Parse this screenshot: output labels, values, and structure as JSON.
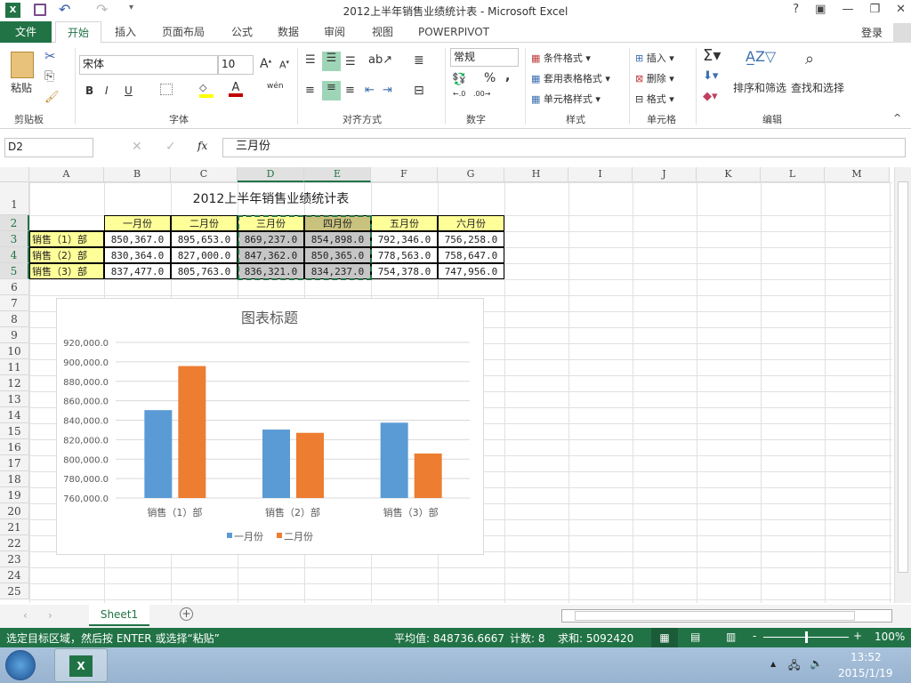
{
  "window": {
    "title": "2012上半年销售业绩统计表 - Microsoft Excel",
    "controls": [
      "?",
      "▣",
      "—",
      "❐",
      "✕"
    ]
  },
  "ribbon_tabs": [
    {
      "label": "文件",
      "active": false,
      "file": true
    },
    {
      "label": "开始",
      "active": true
    },
    {
      "label": "插入"
    },
    {
      "label": "页面布局"
    },
    {
      "label": "公式"
    },
    {
      "label": "数据"
    },
    {
      "label": "审阅"
    },
    {
      "label": "视图"
    },
    {
      "label": "POWERPIVOT"
    }
  ],
  "login": "登录",
  "ribbon": {
    "clipboard": {
      "paste": "粘贴",
      "label": "剪贴板"
    },
    "font": {
      "name": "宋体",
      "size": "10",
      "label": "字体",
      "bold": "B",
      "italic": "I",
      "underline": "U",
      "phonetic": "wén"
    },
    "alignment": {
      "label": "对齐方式"
    },
    "number": {
      "format": "常规",
      "label": "数字",
      "percent": "%",
      "comma": ","
    },
    "styles": {
      "conditional": "条件格式",
      "table": "套用表格格式",
      "cell": "单元格样式",
      "label": "样式"
    },
    "cells": {
      "insert": "插入",
      "delete": "删除",
      "format": "格式",
      "label": "单元格"
    },
    "editing": {
      "sort": "排序和筛选",
      "find": "查找和选择",
      "label": "编辑"
    }
  },
  "formula_bar": {
    "name_box": "D2",
    "formula": "三月份",
    "fx": "fx"
  },
  "columns": [
    "A",
    "B",
    "C",
    "D",
    "E",
    "F",
    "G",
    "H",
    "I",
    "J",
    "K",
    "L",
    "M"
  ],
  "selected_columns": [
    "D",
    "E"
  ],
  "rows": [
    "1",
    "2",
    "3",
    "4",
    "5",
    "6",
    "7",
    "8",
    "9",
    "10",
    "11",
    "12",
    "13",
    "14",
    "15",
    "16",
    "17",
    "18",
    "19",
    "20",
    "21",
    "22",
    "23",
    "24",
    "25"
  ],
  "sheet": {
    "title": "2012上半年销售业绩统计表",
    "headers": [
      "一月份",
      "二月份",
      "三月份",
      "四月份",
      "五月份",
      "六月份"
    ],
    "table": [
      {
        "dept": "销售（1）部",
        "values": [
          "850,367.0",
          "895,653.0",
          "869,237.0",
          "854,898.0",
          "792,346.0",
          "756,258.0"
        ]
      },
      {
        "dept": "销售（2）部",
        "values": [
          "830,364.0",
          "827,000.0",
          "847,362.0",
          "850,365.0",
          "778,563.0",
          "758,647.0"
        ]
      },
      {
        "dept": "销售（3）部",
        "values": [
          "837,477.0",
          "805,763.0",
          "836,321.0",
          "834,237.0",
          "754,378.0",
          "747,956.0"
        ]
      }
    ]
  },
  "chart_data": {
    "type": "bar",
    "title": "图表标题",
    "categories": [
      "销售（1）部",
      "销售（2）部",
      "销售（3）部"
    ],
    "series": [
      {
        "name": "一月份",
        "values": [
          850367,
          830364,
          837477
        ],
        "color": "#5b9bd5"
      },
      {
        "name": "二月份",
        "values": [
          895653,
          827000,
          805763
        ],
        "color": "#ed7d31"
      }
    ],
    "ylim": [
      760000,
      920000
    ],
    "yticks": [
      "760,000.0",
      "780,000.0",
      "800,000.0",
      "820,000.0",
      "840,000.0",
      "860,000.0",
      "880,000.0",
      "900,000.0",
      "920,000.0"
    ],
    "grid": true,
    "legend": "bottom"
  },
  "sheet_tabs": [
    {
      "label": "Sheet1",
      "active": true
    }
  ],
  "status": {
    "message": "选定目标区域，然后按 ENTER 或选择“粘贴”",
    "average": "平均值: 848736.6667",
    "count": "计数: 8",
    "sum": "求和: 5092420",
    "zoom": "100%",
    "zoom_percent": 100
  },
  "taskbar": {
    "time": "13:52",
    "date": "2015/1/19"
  },
  "colors": {
    "accent": "#217346",
    "header_fill": "#ffff99",
    "selected_header_fill": "#c9c27e",
    "selected_fill": "#c6c6c6"
  }
}
